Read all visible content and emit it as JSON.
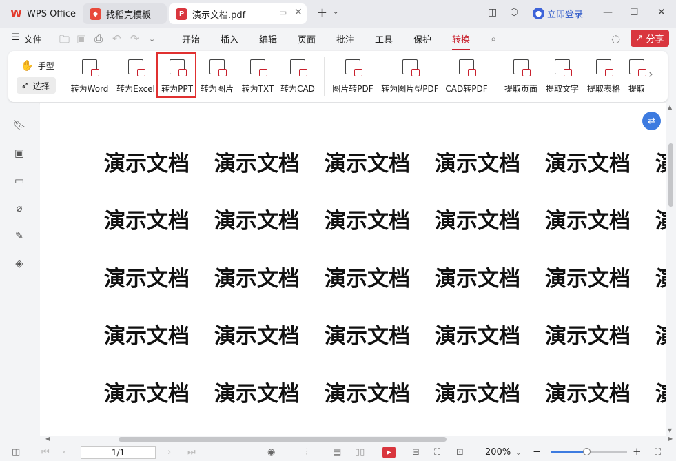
{
  "tabs": [
    {
      "label": "WPS Office",
      "icon": "wps-logo-icon"
    },
    {
      "label": "找稻壳模板",
      "icon": "docer-icon"
    },
    {
      "label": "演示文档.pdf",
      "icon": "pdf-icon"
    }
  ],
  "title_bar": {
    "login_label": "立即登录"
  },
  "menu": {
    "file_label": "文件",
    "items": [
      "开始",
      "插入",
      "编辑",
      "页面",
      "批注",
      "工具",
      "保护",
      "转换"
    ],
    "active": "转换",
    "share_label": "分享"
  },
  "ribbon": {
    "hand_label": "手型",
    "select_label": "选择",
    "buttons": [
      "转为Word",
      "转为Excel",
      "转为PPT",
      "转为图片",
      "转为TXT",
      "转为CAD",
      "图片转PDF",
      "转为图片型PDF",
      "CAD转PDF",
      "提取页面",
      "提取文字",
      "提取表格",
      "提取"
    ],
    "highlighted": "转为PPT"
  },
  "document": {
    "text": "演示文档"
  },
  "status_bar": {
    "page": "1/1",
    "zoom": "200%"
  },
  "colors": {
    "accent": "#c8202d",
    "share": "#d9363e",
    "highlight_box": "#e03030",
    "float_button": "#3d7be0"
  }
}
